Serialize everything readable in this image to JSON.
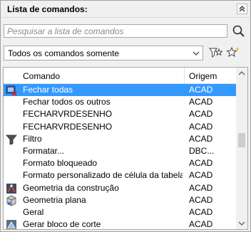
{
  "panel": {
    "title": "Lista de comandos:",
    "search_placeholder": "Pesquisar a lista de comandos",
    "filter_value": "Todos os comandos somente"
  },
  "columns": {
    "command": "Comando",
    "origin": "Origem"
  },
  "rows": [
    {
      "icon": "command-icon",
      "name": "Fechar todas",
      "origin": "ACAD",
      "selected": true
    },
    {
      "icon": "",
      "name": "Fechar todos os outros",
      "origin": "ACAD"
    },
    {
      "icon": "",
      "name": "FECHARVRDESENHO",
      "origin": "ACAD"
    },
    {
      "icon": "",
      "name": "FECHARVRDESENHO",
      "origin": "ACAD"
    },
    {
      "icon": "filter-icon",
      "name": "Filtro",
      "origin": "ACAD"
    },
    {
      "icon": "",
      "name": "Formatar...",
      "origin": "DBC..."
    },
    {
      "icon": "",
      "name": "Formato bloqueado",
      "origin": "ACAD"
    },
    {
      "icon": "",
      "name": "Formato personalizado de célula da tabela...",
      "origin": "ACAD"
    },
    {
      "icon": "construction-geometry-icon",
      "name": "Geometria da construção",
      "origin": "ACAD"
    },
    {
      "icon": "planar-geometry-icon",
      "name": "Geometria plana",
      "origin": "ACAD"
    },
    {
      "icon": "",
      "name": "Geral",
      "origin": "ACAD"
    },
    {
      "icon": "section-block-icon",
      "name": "Gerar bloco de corte",
      "origin": "ACAD"
    }
  ]
}
